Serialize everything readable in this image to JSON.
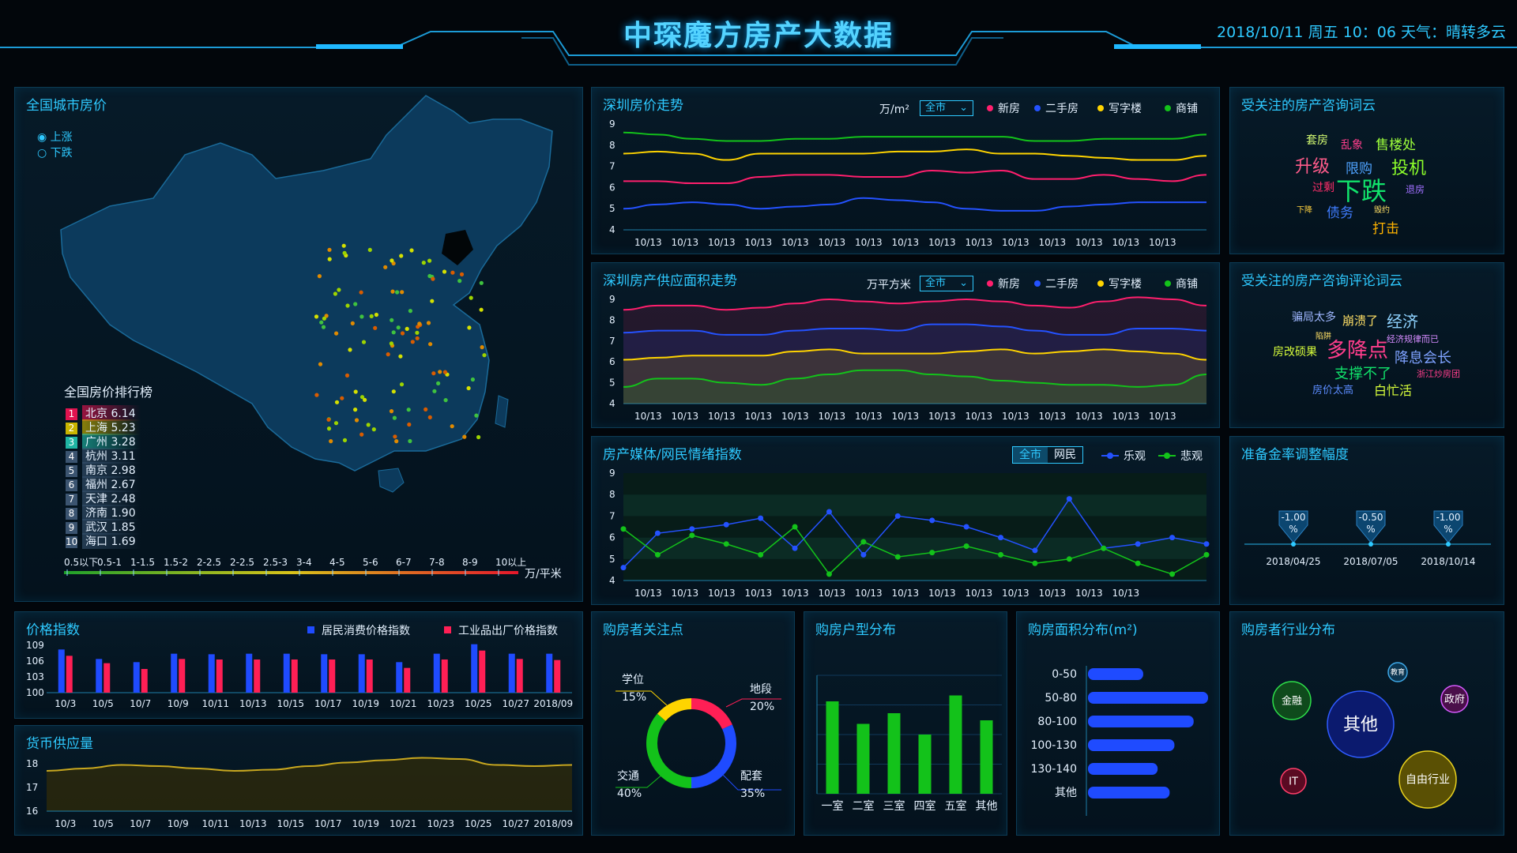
{
  "header": {
    "title": "中琛魔方房产大数据",
    "datetime": "2018/10/11  周五 10：06  天气：晴转多云"
  },
  "map_panel": {
    "title": "全国城市房价",
    "legend_up": "上涨",
    "legend_down": "下跌",
    "rank_title": "全国房价排行榜",
    "ranking": [
      {
        "rank": "1",
        "city": "北京",
        "value": "6.14"
      },
      {
        "rank": "2",
        "city": "上海",
        "value": "5.23"
      },
      {
        "rank": "3",
        "city": "广州",
        "value": "3.28"
      },
      {
        "rank": "4",
        "city": "杭州",
        "value": "3.11"
      },
      {
        "rank": "5",
        "city": "南京",
        "value": "2.98"
      },
      {
        "rank": "6",
        "city": "福州",
        "value": "2.67"
      },
      {
        "rank": "7",
        "city": "天津",
        "value": "2.48"
      },
      {
        "rank": "8",
        "city": "济南",
        "value": "1.90"
      },
      {
        "rank": "9",
        "city": "武汉",
        "value": "1.85"
      },
      {
        "rank": "10",
        "city": "海口",
        "value": "1.69"
      }
    ],
    "rank_colors": [
      "#e0134f",
      "#c9b400",
      "#1fb5a3",
      "#3b5470",
      "#3b5470",
      "#3b5470",
      "#3b5470",
      "#3b5470",
      "#3b5470",
      "#3b5470"
    ],
    "scale_labels": [
      "0.5以下",
      "0.5-1",
      "1-1.5",
      "1.5-2",
      "2-2.5",
      "2-2.5",
      "2.5-3",
      "3-4",
      "4-5",
      "5-6",
      "6-7",
      "7-8",
      "8-9",
      "10以上"
    ],
    "scale_unit": "万/平米"
  },
  "price_trend": {
    "title": "深圳房价走势",
    "unit": "万/m²",
    "select": "全市",
    "legend": [
      "新房",
      "二手房",
      "写字楼",
      "商铺"
    ]
  },
  "supply_trend": {
    "title": "深圳房产供应面积走势",
    "unit": "万平方米",
    "select": "全市",
    "legend": [
      "新房",
      "二手房",
      "写字楼",
      "商铺"
    ]
  },
  "sentiment": {
    "title": "房产媒体/网民情绪指数",
    "toggle": [
      "全市",
      "网民"
    ],
    "legend": [
      "乐观",
      "悲观"
    ]
  },
  "words1": {
    "title": "受关注的房产咨询词云",
    "words": [
      {
        "text": "套房",
        "size": 14,
        "color": "#d7ff74"
      },
      {
        "text": "乱象",
        "size": 14,
        "color": "#ff3e8c"
      },
      {
        "text": "售楼处",
        "size": 17,
        "color": "#9dff3b"
      },
      {
        "text": "升级",
        "size": 22,
        "color": "#ff5b8a"
      },
      {
        "text": "限购",
        "size": 17,
        "color": "#4fa3ff"
      },
      {
        "text": "投机",
        "size": 22,
        "color": "#8dff2a"
      },
      {
        "text": "过剩",
        "size": 14,
        "color": "#ff2e6a"
      },
      {
        "text": "下跌",
        "size": 32,
        "color": "#11e36b"
      },
      {
        "text": "退房",
        "size": 12,
        "color": "#a070ff"
      },
      {
        "text": "下降",
        "size": 10,
        "color": "#ffd23f"
      },
      {
        "text": "债务",
        "size": 17,
        "color": "#3f7dff"
      },
      {
        "text": "毁约",
        "size": 10,
        "color": "#ffe066"
      },
      {
        "text": "打击",
        "size": 17,
        "color": "#ffb300"
      }
    ]
  },
  "words2": {
    "title": "受关注的房产咨询评论词云",
    "words": [
      {
        "text": "骗局太多",
        "size": 14,
        "color": "#9fb7ff"
      },
      {
        "text": "崩溃了",
        "size": 15,
        "color": "#ffe066"
      },
      {
        "text": "经济",
        "size": 20,
        "color": "#8fd3ff"
      },
      {
        "text": "陷阱",
        "size": 10,
        "color": "#ffe066"
      },
      {
        "text": "房改硕果",
        "size": 14,
        "color": "#d9ff3b"
      },
      {
        "text": "多降点",
        "size": 26,
        "color": "#ff3e8c"
      },
      {
        "text": "经济规律而已",
        "size": 11,
        "color": "#d58cff"
      },
      {
        "text": "降息会长",
        "size": 18,
        "color": "#7ea2ff"
      },
      {
        "text": "支撑不了",
        "size": 18,
        "color": "#11e36b"
      },
      {
        "text": "浙江炒房团",
        "size": 11,
        "color": "#ff3e8c"
      },
      {
        "text": "房价太高",
        "size": 13,
        "color": "#5b8cff"
      },
      {
        "text": "白忙活",
        "size": 16,
        "color": "#d9ff3b"
      }
    ]
  },
  "reserve": {
    "title": "准备金率调整幅度",
    "points": [
      {
        "value": "-1.00",
        "unit": "%",
        "date": "2018/04/25"
      },
      {
        "value": "-0.50",
        "unit": "%",
        "date": "2018/07/05"
      },
      {
        "value": "-1.00",
        "unit": "%",
        "date": "2018/10/14"
      }
    ]
  },
  "price_index": {
    "title": "价格指数",
    "legend": [
      "居民消费价格指数",
      "工业品出厂价格指数"
    ]
  },
  "money_supply": {
    "title": "货币供应量"
  },
  "focus": {
    "title": "购房者关注点"
  },
  "layout_dist": {
    "title": "购房户型分布"
  },
  "area_dist": {
    "title": "购房面积分布(m²)"
  },
  "industry": {
    "title": "购房者行业分布",
    "bubbles": [
      {
        "label": "金融",
        "fill": "#0f4a1c",
        "stroke": "#2ee04a"
      },
      {
        "label": "教育",
        "fill": "#0b3550",
        "stroke": "#3fa9e8"
      },
      {
        "label": "政府",
        "fill": "#4a0f4a",
        "stroke": "#d85bff"
      },
      {
        "label": "其他",
        "fill": "#0b1a6e",
        "stroke": "#2f5bff"
      },
      {
        "label": "IT",
        "fill": "#5a0a22",
        "stroke": "#ff3e6a"
      },
      {
        "label": "自由行业",
        "fill": "#5a5004",
        "stroke": "#e8d11f"
      }
    ]
  },
  "chart_data": [
    {
      "id": "price_trend",
      "type": "line",
      "title": "深圳房价走势",
      "ylabel": "万/m²",
      "x": [
        "10/13",
        "10/13",
        "10/13",
        "10/13",
        "10/13",
        "10/13",
        "10/13",
        "10/13",
        "10/13",
        "10/13",
        "10/13",
        "10/13",
        "10/13",
        "10/13",
        "10/13"
      ],
      "ylim": [
        4,
        9
      ],
      "yticks": [
        4,
        5,
        6,
        7,
        8,
        9
      ],
      "series": [
        {
          "name": "新房",
          "color": "#ff1f6d",
          "values": [
            6.3,
            6.3,
            6.2,
            6.2,
            6.5,
            6.6,
            6.6,
            6.5,
            6.5,
            6.8,
            6.7,
            6.8,
            6.4,
            6.4,
            6.6,
            6.4,
            6.3,
            6.6
          ]
        },
        {
          "name": "二手房",
          "color": "#2452ff",
          "values": [
            5.0,
            5.2,
            5.3,
            5.2,
            5.0,
            5.1,
            5.2,
            5.5,
            5.4,
            5.3,
            5.0,
            4.9,
            4.9,
            5.1,
            5.2,
            5.3,
            5.3,
            5.3
          ]
        },
        {
          "name": "写字楼",
          "color": "#ffd400",
          "values": [
            7.6,
            7.7,
            7.6,
            7.3,
            7.6,
            7.6,
            7.6,
            7.6,
            7.7,
            7.7,
            7.8,
            7.6,
            7.6,
            7.5,
            7.4,
            7.3,
            7.3,
            7.5
          ]
        },
        {
          "name": "商铺",
          "color": "#13c21a",
          "values": [
            8.6,
            8.5,
            8.3,
            8.2,
            8.2,
            8.3,
            8.3,
            8.4,
            8.4,
            8.4,
            8.4,
            8.4,
            8.2,
            8.2,
            8.3,
            8.3,
            8.3,
            8.5
          ]
        }
      ]
    },
    {
      "id": "supply_trend",
      "type": "area",
      "title": "深圳房产供应面积走势",
      "ylabel": "万平方米",
      "x": [
        "10/13",
        "10/13",
        "10/13",
        "10/13",
        "10/13",
        "10/13",
        "10/13",
        "10/13",
        "10/13",
        "10/13",
        "10/13",
        "10/13",
        "10/13",
        "10/13",
        "10/13"
      ],
      "ylim": [
        4,
        9
      ],
      "yticks": [
        4,
        5,
        6,
        7,
        8,
        9
      ],
      "series": [
        {
          "name": "新房",
          "color": "#ff1f6d",
          "values": [
            8.5,
            8.7,
            8.7,
            8.5,
            8.6,
            8.8,
            9.0,
            8.9,
            8.8,
            8.9,
            9.0,
            8.9,
            8.7,
            8.6,
            8.9,
            9.1,
            9.0,
            8.7
          ]
        },
        {
          "name": "二手房",
          "color": "#2452ff",
          "values": [
            7.4,
            7.5,
            7.5,
            7.3,
            7.3,
            7.5,
            7.6,
            7.6,
            7.5,
            7.8,
            7.8,
            7.7,
            7.5,
            7.3,
            7.3,
            7.6,
            7.6,
            7.5
          ]
        },
        {
          "name": "写字楼",
          "color": "#ffd400",
          "values": [
            6.1,
            6.2,
            6.3,
            6.3,
            6.3,
            6.5,
            6.6,
            6.4,
            6.4,
            6.4,
            6.5,
            6.6,
            6.4,
            6.5,
            6.6,
            6.5,
            6.4,
            6.1
          ]
        },
        {
          "name": "商铺",
          "color": "#13c21a",
          "values": [
            4.8,
            5.2,
            5.2,
            5.0,
            4.9,
            5.2,
            5.4,
            5.6,
            5.6,
            5.4,
            5.3,
            5.1,
            5.0,
            4.9,
            4.9,
            4.8,
            4.9,
            5.4
          ]
        }
      ]
    },
    {
      "id": "sentiment",
      "type": "line",
      "title": "房产媒体/网民情绪指数",
      "x": [
        "10/13",
        "10/13",
        "10/13",
        "10/13",
        "10/13",
        "10/13",
        "10/13",
        "10/13",
        "10/13",
        "10/13",
        "10/13",
        "10/13",
        "10/13",
        "10/13"
      ],
      "ylim": [
        4,
        9
      ],
      "yticks": [
        4,
        5,
        6,
        7,
        8,
        9
      ],
      "series": [
        {
          "name": "乐观",
          "color": "#2452ff",
          "values": [
            4.6,
            6.2,
            6.4,
            6.6,
            6.9,
            5.5,
            7.2,
            5.2,
            7.0,
            6.8,
            6.5,
            6.0,
            5.4,
            7.8,
            5.5,
            5.7,
            6.0,
            5.7
          ]
        },
        {
          "name": "悲观",
          "color": "#13c21a",
          "values": [
            6.4,
            5.2,
            6.1,
            5.7,
            5.2,
            6.5,
            4.3,
            5.8,
            5.1,
            5.3,
            5.6,
            5.2,
            4.8,
            5.0,
            5.5,
            4.8,
            4.3,
            5.2
          ]
        }
      ]
    },
    {
      "id": "price_index",
      "type": "bar",
      "title": "价格指数",
      "categories": [
        "10/3",
        "10/5",
        "10/7",
        "10/9",
        "10/11",
        "10/13",
        "10/15",
        "10/17",
        "10/19",
        "10/21",
        "10/23",
        "10/25",
        "10/27",
        "2018/09"
      ],
      "ylim": [
        100,
        109
      ],
      "yticks": [
        100,
        103,
        106,
        109
      ],
      "series": [
        {
          "name": "居民消费价格指数",
          "color": "#1f4bff",
          "values": [
            108.2,
            106.4,
            105.8,
            107.4,
            107.3,
            107.4,
            107.4,
            107.3,
            107.3,
            105.8,
            107.4,
            109.2,
            107.4,
            107.4
          ]
        },
        {
          "name": "工业品出厂价格指数",
          "color": "#ff1f55",
          "values": [
            107.0,
            105.6,
            104.5,
            106.4,
            106.3,
            106.3,
            106.3,
            106.3,
            106.3,
            104.7,
            106.3,
            108.0,
            106.4,
            106.2
          ]
        }
      ]
    },
    {
      "id": "money_supply",
      "type": "area",
      "title": "货币供应量",
      "categories": [
        "10/3",
        "10/5",
        "10/7",
        "10/9",
        "10/11",
        "10/13",
        "10/15",
        "10/17",
        "10/19",
        "10/21",
        "10/23",
        "10/25",
        "10/27",
        "2018/09"
      ],
      "ylim": [
        16,
        18
      ],
      "yticks": [
        16,
        17,
        18
      ],
      "series": [
        {
          "name": "",
          "color": "#c9a81f",
          "values": [
            17.7,
            17.8,
            17.95,
            17.9,
            17.8,
            17.7,
            17.75,
            17.9,
            18.05,
            18.15,
            18.25,
            18.2,
            17.95,
            17.9,
            17.95
          ]
        }
      ]
    },
    {
      "id": "focus",
      "type": "pie",
      "title": "购房者关注点",
      "slices": [
        {
          "label": "地段",
          "value": 20,
          "percent": "20%",
          "color": "#ff1f55"
        },
        {
          "label": "配套",
          "value": 35,
          "percent": "35%",
          "color": "#1f4bff"
        },
        {
          "label": "交通",
          "value": 40,
          "percent": "40%",
          "color": "#13c21a"
        },
        {
          "label": "学位",
          "value": 15,
          "percent": "15%",
          "color": "#ffd400"
        }
      ]
    },
    {
      "id": "layout_dist",
      "type": "bar",
      "title": "购房户型分布",
      "categories": [
        "一室",
        "二室",
        "三室",
        "四室",
        "五室",
        "其他"
      ],
      "values": [
        7.8,
        5.9,
        6.8,
        5.0,
        8.3,
        6.2
      ],
      "color": "#13c21a"
    },
    {
      "id": "area_dist",
      "type": "bar",
      "title": "购房面积分布(m²)",
      "orientation": "horizontal",
      "categories": [
        "0-50",
        "50-80",
        "80-100",
        "100-130",
        "130-140",
        "其他"
      ],
      "values": [
        46,
        100,
        88,
        72,
        58,
        68
      ],
      "color": "#1f4bff"
    }
  ]
}
